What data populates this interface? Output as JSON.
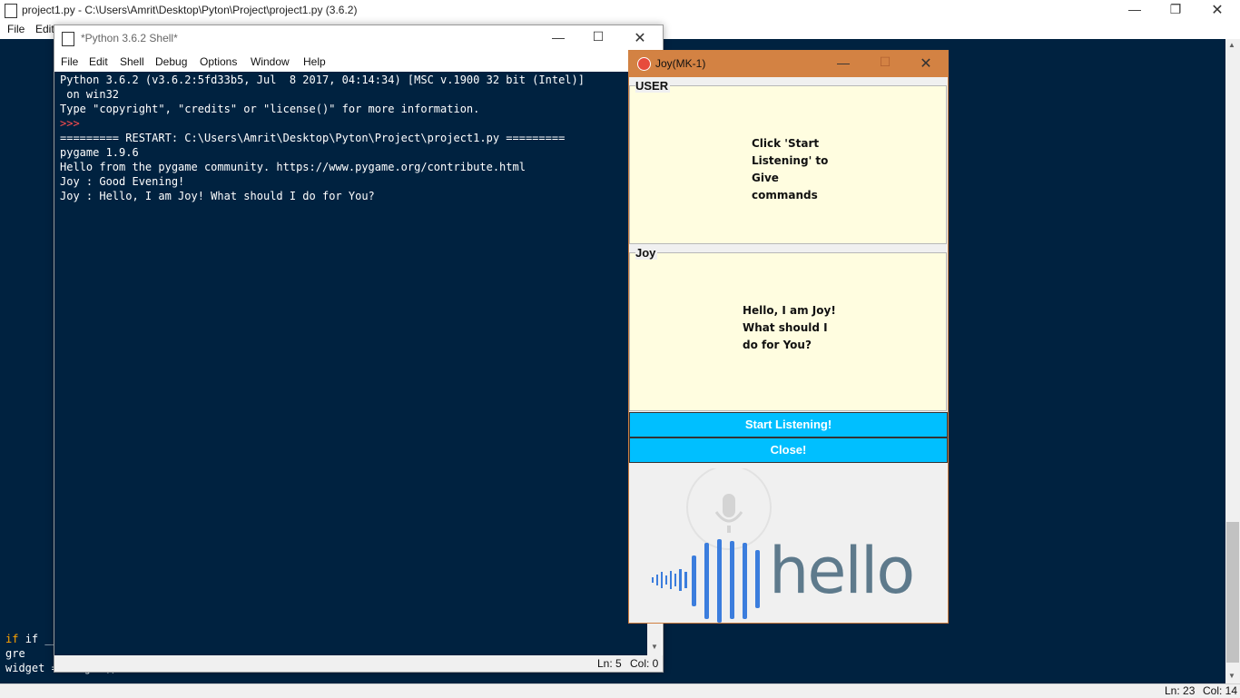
{
  "editor": {
    "title": "project1.py - C:\\Users\\Amrit\\Desktop\\Pyton\\Project\\project1.py (3.6.2)",
    "menu": [
      "File",
      "Edit"
    ],
    "code_lines": [
      "if __na",
      "    gre",
      "    widget = widget()"
    ],
    "status": {
      "line": "Ln: 23",
      "col": "Col: 14"
    }
  },
  "shell": {
    "title": "*Python 3.6.2 Shell*",
    "menu": [
      "File",
      "Edit",
      "Shell",
      "Debug",
      "Options",
      "Window",
      "Help"
    ],
    "lines": [
      "Python 3.6.2 (v3.6.2:5fd33b5, Jul  8 2017, 04:14:34) [MSC v.1900 32 bit (Intel)]",
      " on win32",
      "Type \"copyright\", \"credits\" or \"license()\" for more information.",
      ">>> ",
      "========= RESTART: C:\\Users\\Amrit\\Desktop\\Pyton\\Project\\project1.py =========",
      "pygame 1.9.6",
      "Hello from the pygame community. https://www.pygame.org/contribute.html",
      "Joy : Good Evening!",
      "Joy : Hello, I am Joy! What should I do for You?"
    ],
    "prompt_color": "#ff4d4d",
    "status": {
      "line": "Ln: 5",
      "col": "Col: 0"
    }
  },
  "joy": {
    "title": "Joy(MK-1)",
    "user_label": "USER",
    "user_text": "Click 'Start Listening' to Give commands",
    "joy_label": "Joy",
    "joy_text": "Hello, I am Joy! What should I do for You?",
    "start_button": "Start Listening!",
    "close_button": "Close!",
    "logo_word": "hello",
    "accent": "#00bfff",
    "titlebar_color": "#d38243"
  }
}
